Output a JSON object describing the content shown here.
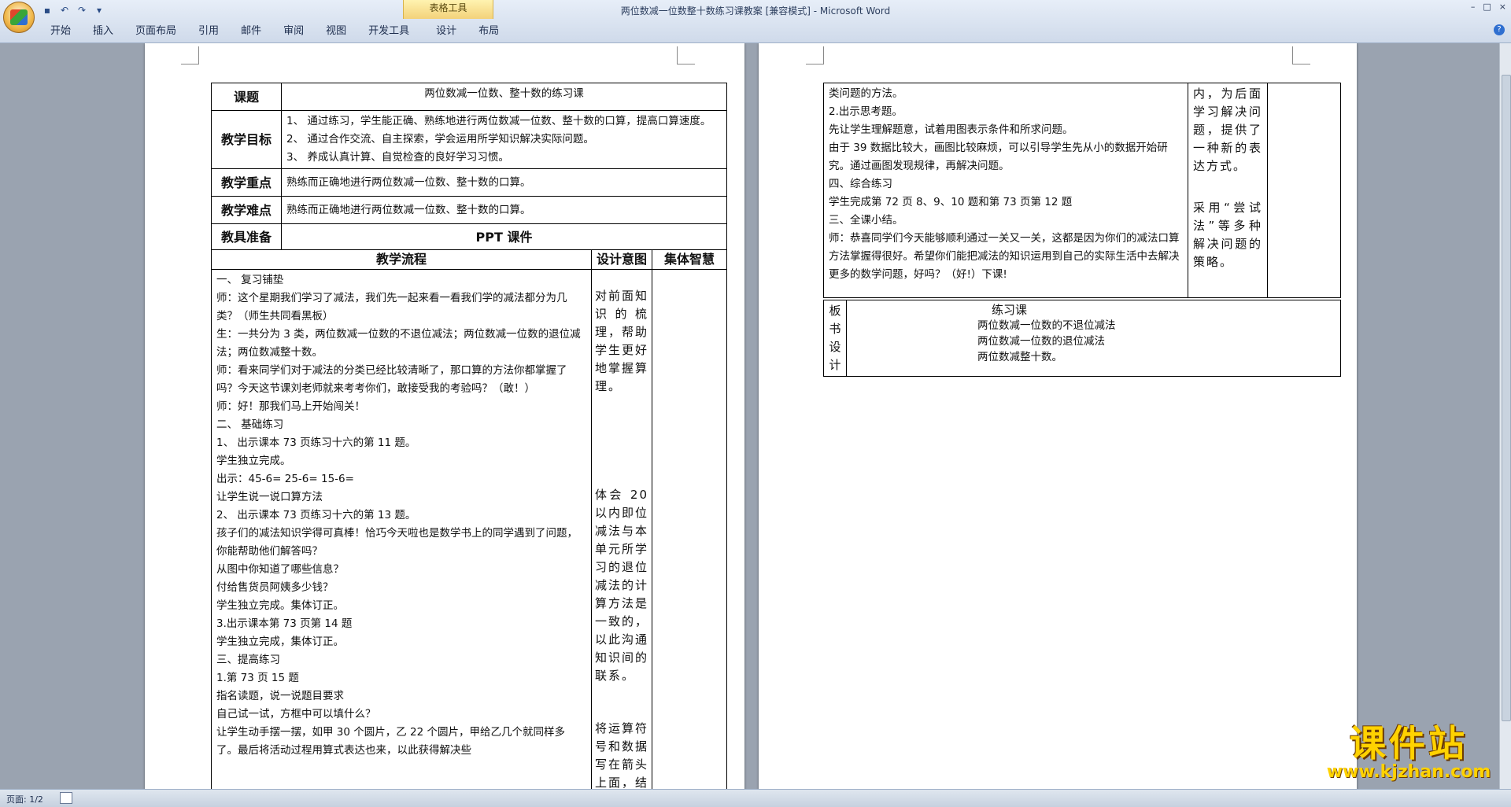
{
  "window": {
    "title": "两位数减一位数整十数练习课教案 [兼容模式] - Microsoft Word",
    "context_tools_label": "表格工具",
    "controls": [
      "–",
      "□",
      "×"
    ]
  },
  "quick_access": [
    "save-icon",
    "undo-icon",
    "redo-icon",
    "customize-icon"
  ],
  "ribbon_tabs": [
    "开始",
    "插入",
    "页面布局",
    "引用",
    "邮件",
    "审阅",
    "视图",
    "开发工具",
    "设计",
    "布局"
  ],
  "page1": {
    "topic_label": "课题",
    "topic_value": "两位数减一位数、整十数的练习课",
    "goals_label": "教学目标",
    "goals": [
      "1、 通过练习，学生能正确、熟练地进行两位数减一位数、整十数的口算，提高口算速度。",
      "2、 通过合作交流、自主探索，学会运用所学知识解决实际问题。",
      "3、 养成认真计算、自觉检查的良好学习习惯。"
    ],
    "key_label": "教学重点",
    "key_value": "熟练而正确地进行两位数减一位数、整十数的口算。",
    "difficulty_label": "教学难点",
    "difficulty_value": "熟练而正确地进行两位数减一位数、整十数的口算。",
    "prep_label": "教具准备",
    "prep_value": "PPT 课件",
    "flow_header": "教学流程",
    "intent_header": "设计意图",
    "wisdom_header": "集体智慧",
    "flow_lines": [
      "一、 复习铺垫",
      "师：这个星期我们学习了减法，我们先一起来看一看我们学的减法都分为几类？（师生共同看黑板）",
      "生：一共分为 3 类，两位数减一位数的不退位减法；两位数减一位数的退位减法；两位数减整十数。",
      "师：看来同学们对于减法的分类已经比较清晰了，那口算的方法你都掌握了吗？今天这节课刘老师就来考考你们，敢接受我的考验吗？（敢！）",
      "师：好！那我们马上开始闯关！",
      "二、 基础练习",
      "1、 出示课本 73 页练习十六的第 11 题。",
      "学生独立完成。",
      "出示：45-6=   25-6=   15-6=",
      "让学生说一说口算方法",
      "2、 出示课本 73 页练习十六的第 13 题。",
      "孩子们的减法知识学得可真棒！恰巧今天啦也是数学书上的同学遇到了问题，你能帮助他们解答吗？",
      "从图中你知道了哪些信息？",
      "付给售货员阿姨多少钱？",
      "学生独立完成。集体订正。",
      "3.出示课本第 73 页第 14 题",
      "学生独立完成，集体订正。",
      "三、提高练习",
      "1.第 73 页 15 题",
      "指名读题，说一说题目要求",
      "自己试一试，方框中可以填什么？",
      "让学生动手摆一摆，如甲 30 个圆片，乙 22 个圆片，甲给乙几个就同样多了。最后将活动过程用算式表达也来，以此获得解决些"
    ],
    "intent_blocks": [
      "对前面知识的梳理，帮助学生更好地掌握算理。",
      "体会 20 以内即位减法与本单元所学习的退位减法的计算方法是一致的，以此沟通知识间的联系。",
      "将运算符号和数据写在箭头上面，结果写在方框"
    ]
  },
  "page2": {
    "flow_lines": [
      "类问题的方法。",
      "2.出示思考题。",
      "先让学生理解题意，试着用图表示条件和所求问题。",
      "由于 39 数据比较大，画图比较麻烦，可以引导学生先从小的数据开始研究。通过画图发现规律，再解决问题。",
      "四、综合练习",
      "学生完成第 72 页 8、9、10 题和第 73 页第 12 题",
      "三、全课小结。",
      "师：恭喜同学们今天能够顺利通过一关又一关，这都是因为你们的减法口算方法掌握得很好。希望你们能把减法的知识运用到自己的实际生活中去解决更多的数学问题，好吗？（好!）下课!"
    ],
    "intent_blocks": [
      "内，为后面学习解决问题，提供了一种新的表达方式。",
      "采用“尝试法”等多种解决问题的策略。"
    ],
    "board_label": "板书设计",
    "board_title": "练习课",
    "board_lines": [
      "两位数减一位数的不退位减法",
      "两位数减一位数的退位减法",
      "两位数减整十数。"
    ]
  },
  "watermark": {
    "main": "课件站",
    "url": "www.kjzhan.com"
  },
  "status": {
    "page": "页面: 1/2"
  }
}
